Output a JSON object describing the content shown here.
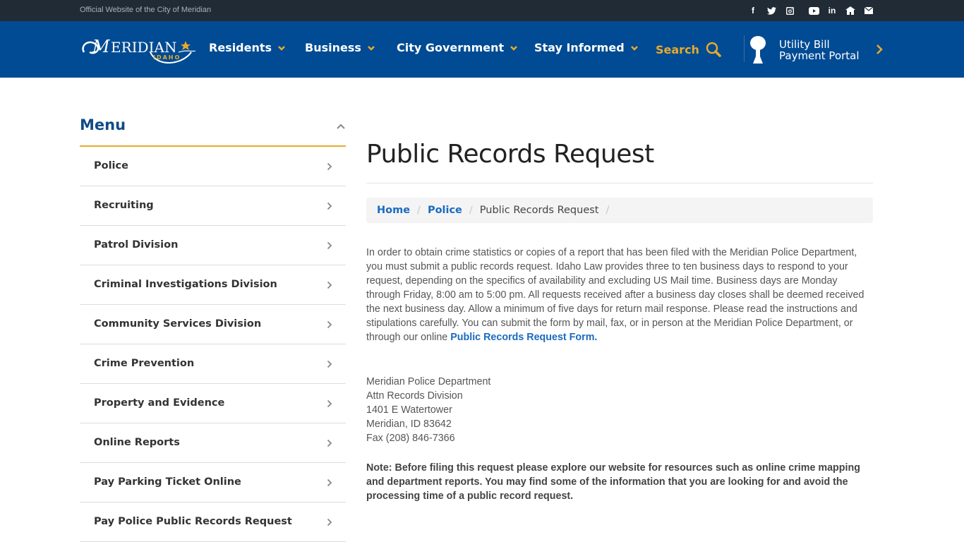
{
  "topbar": {
    "official_text": "Official Website of the City of Meridian",
    "social_icons": [
      "facebook-icon",
      "twitter-icon",
      "instagram-icon",
      "youtube-icon",
      "linkedin-icon",
      "nextdoor-icon",
      "email-icon"
    ]
  },
  "header": {
    "logo_text": "MERIDIAN",
    "logo_subtext": "IDAHO",
    "nav": [
      {
        "label": "Residents"
      },
      {
        "label": "Business"
      },
      {
        "label": "City Government"
      },
      {
        "label": "Stay Informed"
      }
    ],
    "search_label": "Search",
    "utility_line1": "Utility Bill",
    "utility_line2": "Payment Portal",
    "colors": {
      "brand_blue": "#004b93",
      "accent_gold": "#e8aa2b",
      "topbar": "#212b36"
    }
  },
  "sidebar": {
    "title": "Menu",
    "items": [
      {
        "label": "Police"
      },
      {
        "label": "Recruiting"
      },
      {
        "label": "Patrol Division"
      },
      {
        "label": "Criminal Investigations Division"
      },
      {
        "label": "Community Services Division"
      },
      {
        "label": "Crime Prevention"
      },
      {
        "label": "Property and Evidence"
      },
      {
        "label": "Online Reports"
      },
      {
        "label": "Pay Parking Ticket Online"
      },
      {
        "label": "Pay Police Public Records Request"
      }
    ]
  },
  "main": {
    "title": "Public Records Request",
    "breadcrumb": {
      "home": "Home",
      "parent": "Police",
      "current": "Public Records Request",
      "separator": "/"
    },
    "intro_text": "In order to obtain crime statistics or copies of a report that has been filed with the Meridian Police Department, you must submit a public records request. Idaho Law provides three to ten business days to respond to your request, depending on the specifics of availability and excluding US Mail time. Business days are Monday through Friday, 8:00 am to 5:00 pm. All requests received after a business day closes shall be deemed received the next business day. Allow a minimum of five days for return mail response. Please read the instructions and stipulations carefully. You can submit the form by mail, fax, or in person at the Meridian Police Department, or through our online ",
    "form_link": "Public Records Request Form.",
    "address": [
      "Meridian Police Department",
      "Attn Records Division",
      "1401 E Watertower",
      "Meridian, ID 83642",
      "Fax (208) 846-7366"
    ],
    "note": "Note: Before filing this request please explore our website for resources such as online crime mapping and department reports. You may find some of the information that you are looking for and avoid the processing time of a public record request."
  }
}
